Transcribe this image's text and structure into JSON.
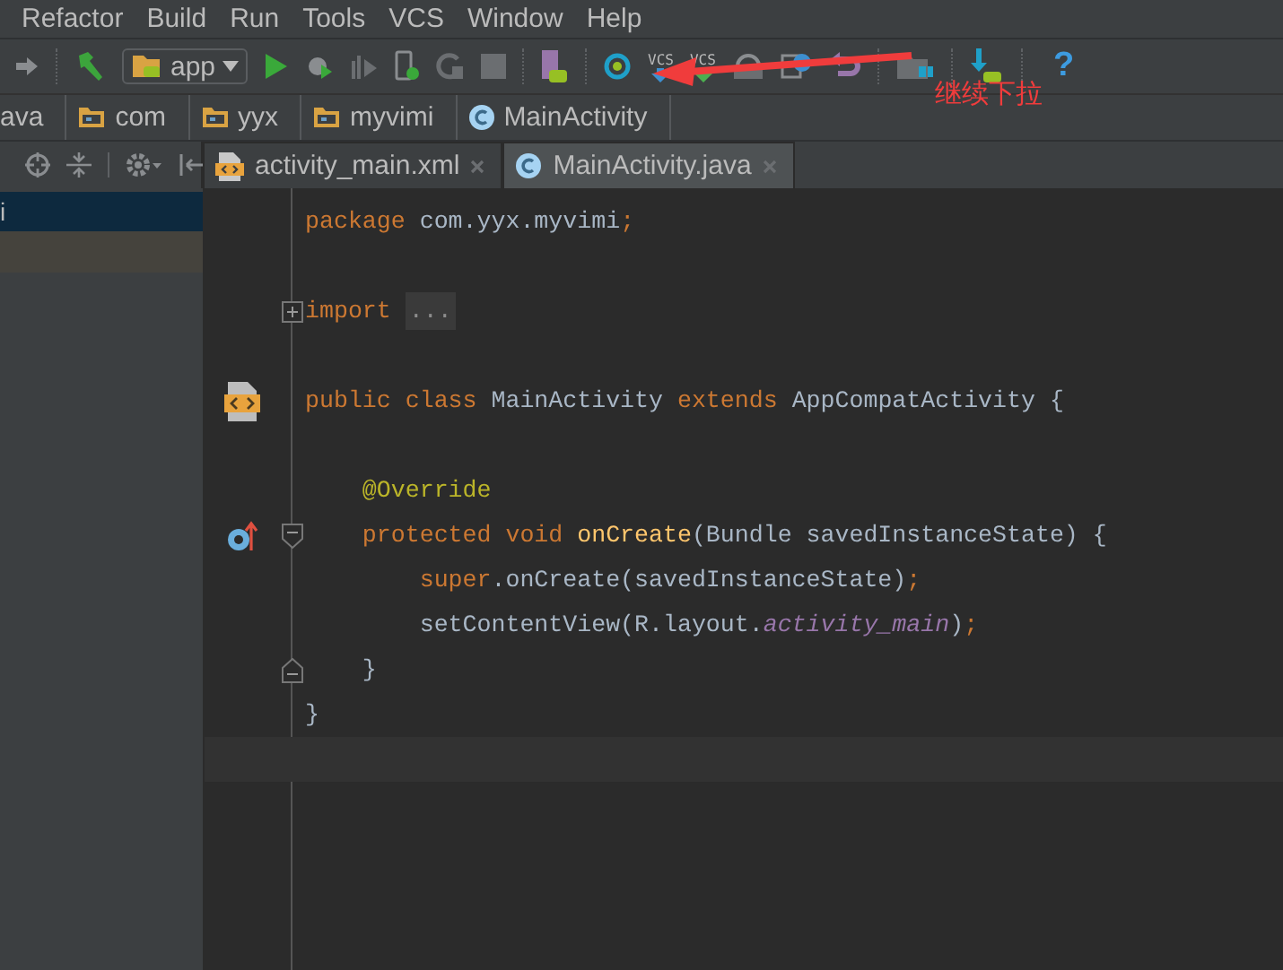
{
  "menu": [
    {
      "label": "Refactor"
    },
    {
      "label": "Build"
    },
    {
      "label": "Run"
    },
    {
      "label": "Tools"
    },
    {
      "label": "VCS"
    },
    {
      "label": "Window"
    },
    {
      "label": "Help"
    }
  ],
  "toolbar": {
    "run_config": "app",
    "vcs_labels": [
      "VCS",
      "VCS"
    ],
    "help": "?"
  },
  "breadcrumbs": [
    {
      "label": "ava",
      "kind": "plain"
    },
    {
      "label": "com",
      "kind": "folder"
    },
    {
      "label": "yyx",
      "kind": "folder"
    },
    {
      "label": "myvimi",
      "kind": "folder"
    },
    {
      "label": "MainActivity",
      "kind": "class"
    }
  ],
  "tabs": [
    {
      "label": "activity_main.xml",
      "kind": "xml",
      "selected": false
    },
    {
      "label": "MainActivity.java",
      "kind": "class",
      "selected": true
    }
  ],
  "project_tree": [
    {
      "label": "i",
      "selected": true
    }
  ],
  "code": [
    {
      "kind": "code",
      "tokens": [
        {
          "kind": "keyword",
          "text": "package "
        },
        {
          "kind": "plain",
          "text": "com.yyx.myvimi"
        },
        {
          "kind": "keyword",
          "text": ";"
        }
      ]
    },
    {
      "kind": "blank"
    },
    {
      "kind": "code",
      "fold": {
        "kind": "expand"
      },
      "tokens": [
        {
          "kind": "keyword",
          "text": "import "
        },
        {
          "kind": "folded",
          "text": "..."
        }
      ]
    },
    {
      "kind": "blank"
    },
    {
      "kind": "code",
      "gutter": {
        "kind": "layout"
      },
      "tokens": [
        {
          "kind": "keyword",
          "text": "public class "
        },
        {
          "kind": "plain",
          "text": "MainActivity "
        },
        {
          "kind": "keyword",
          "text": "extends "
        },
        {
          "kind": "plain",
          "text": "AppCompatActivity {"
        }
      ]
    },
    {
      "kind": "blank"
    },
    {
      "kind": "code",
      "tokens": [
        {
          "kind": "annotation",
          "text": "    @Override"
        }
      ]
    },
    {
      "kind": "code",
      "gutter": {
        "kind": "override"
      },
      "fold": {
        "kind": "collapse"
      },
      "tokens": [
        {
          "kind": "keyword",
          "text": "    protected void "
        },
        {
          "kind": "method",
          "text": "onCreate"
        },
        {
          "kind": "plain",
          "text": "(Bundle savedInstanceState) {"
        }
      ]
    },
    {
      "kind": "code",
      "tokens": [
        {
          "kind": "keyword",
          "text": "        super"
        },
        {
          "kind": "plain",
          "text": ".onCreate(savedInstanceState)"
        },
        {
          "kind": "keyword",
          "text": ";"
        }
      ]
    },
    {
      "kind": "code",
      "tokens": [
        {
          "kind": "plain",
          "text": "        setContentView(R.layout."
        },
        {
          "kind": "field",
          "text": "activity_main"
        },
        {
          "kind": "plain",
          "text": ")"
        },
        {
          "kind": "keyword",
          "text": ";"
        }
      ]
    },
    {
      "kind": "code",
      "fold": {
        "kind": "end"
      },
      "tokens": [
        {
          "kind": "plain",
          "text": "    }"
        }
      ]
    },
    {
      "kind": "code",
      "tokens": [
        {
          "kind": "plain",
          "text": "}"
        }
      ]
    },
    {
      "kind": "caret"
    }
  ],
  "annotation": {
    "text": "继续下拉"
  }
}
